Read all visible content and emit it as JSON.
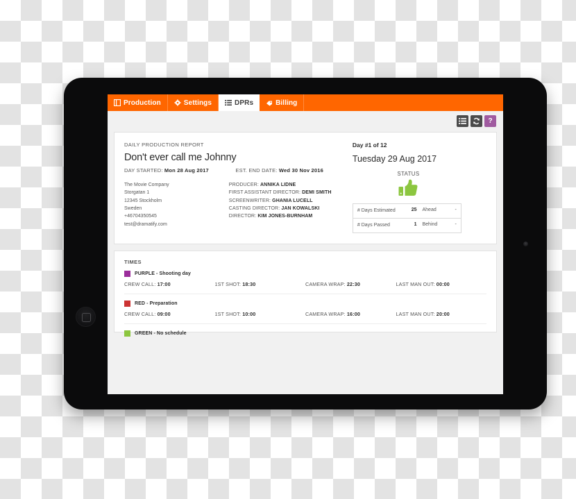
{
  "tabs": [
    {
      "label": "Production",
      "icon": "book-icon",
      "active": false
    },
    {
      "label": "Settings",
      "icon": "gear-icon",
      "active": false
    },
    {
      "label": "DPRs",
      "icon": "list-icon",
      "active": true
    },
    {
      "label": "Billing",
      "icon": "tag-icon",
      "active": false
    }
  ],
  "toolbar": {
    "list_icon": "list-icon",
    "refresh_icon": "refresh-icon",
    "help_label": "?"
  },
  "report": {
    "kicker": "DAILY PRODUCTION REPORT",
    "title": "Don't ever call me Johnny",
    "day_started_label": "DAY STARTED:",
    "day_started_value": "Mon 28 Aug 2017",
    "est_end_label": "EST. END DATE:",
    "est_end_value": "Wed 30 Nov 2016",
    "company": {
      "name": "The Movie Company",
      "street": "Storgatan 1",
      "city": "12345 Stockholm",
      "country": "Sweden",
      "phone": "+46704350545",
      "email": "test@dramatify.com"
    },
    "credits": [
      {
        "role": "PRODUCER:",
        "name": "ANNIKA LIDNE"
      },
      {
        "role": "FIRST ASSISTANT DIRECTOR:",
        "name": "DEMI SMITH"
      },
      {
        "role": "SCREENWRITER:",
        "name": "GHANIA LUCELL"
      },
      {
        "role": "CASTING DIRECTOR:",
        "name": "JAN KOWALSKI"
      },
      {
        "role": "DIRECTOR:",
        "name": "KIM JONES-BURNHAM"
      }
    ],
    "day_counter": "Day #1 of 12",
    "day_date": "Tuesday 29 Aug 2017",
    "status_label": "STATUS",
    "status_icon": "thumbs-up-icon",
    "status_color": "#8cc63f",
    "stats": [
      {
        "name": "# Days Estimated",
        "value": "25",
        "compare": "Ahead",
        "dash": "-"
      },
      {
        "name": "# Days Passed",
        "value": "1",
        "compare": "Behind",
        "dash": "-"
      }
    ]
  },
  "times": {
    "heading": "TIMES",
    "groups": [
      {
        "swatch_color": "#9b2d9b",
        "label": "PURPLE - Shooting day",
        "rows": [
          {
            "label": "CREW CALL:",
            "value": "17:00"
          },
          {
            "label": "1ST SHOT:",
            "value": "18:30"
          },
          {
            "label": "CAMERA WRAP:",
            "value": "22:30"
          },
          {
            "label": "LAST MAN OUT:",
            "value": "00:00"
          }
        ]
      },
      {
        "swatch_color": "#cc3333",
        "label": "RED - Preparation",
        "rows": [
          {
            "label": "CREW CALL:",
            "value": "09:00"
          },
          {
            "label": "1ST SHOT:",
            "value": "10:00"
          },
          {
            "label": "CAMERA WRAP:",
            "value": "16:00"
          },
          {
            "label": "LAST MAN OUT:",
            "value": "20:00"
          }
        ]
      },
      {
        "swatch_color": "#8cc63f",
        "label": "GREEN - No schedule",
        "rows": []
      }
    ]
  },
  "theme": {
    "accent_orange": "#ff6600",
    "help_purple": "#a05ba0",
    "toolbar_dark": "#4b4b4b"
  }
}
